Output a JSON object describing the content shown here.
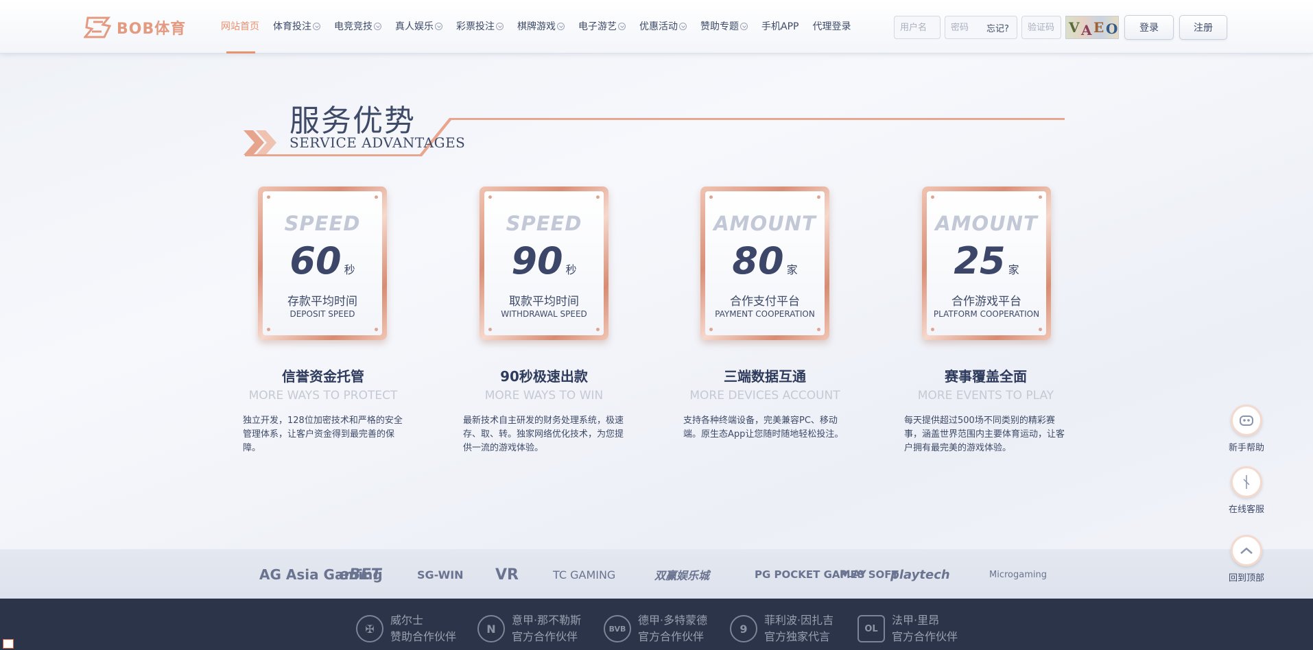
{
  "header": {
    "brand": "BOB体育",
    "nav": [
      {
        "label": "网站首页",
        "active": true,
        "dropdown": false
      },
      {
        "label": "体育投注",
        "active": false,
        "dropdown": true
      },
      {
        "label": "电竞竞技",
        "active": false,
        "dropdown": true
      },
      {
        "label": "真人娱乐",
        "active": false,
        "dropdown": true
      },
      {
        "label": "彩票投注",
        "active": false,
        "dropdown": true
      },
      {
        "label": "棋牌游戏",
        "active": false,
        "dropdown": true
      },
      {
        "label": "电子游艺",
        "active": false,
        "dropdown": true
      },
      {
        "label": "优惠活动",
        "active": false,
        "dropdown": true
      },
      {
        "label": "赞助专题",
        "active": false,
        "dropdown": true
      },
      {
        "label": "手机APP",
        "active": false,
        "dropdown": false
      },
      {
        "label": "代理登录",
        "active": false,
        "dropdown": false
      }
    ],
    "login": {
      "username_placeholder": "用户名",
      "password_placeholder": "密码",
      "forgot_label": "忘记?",
      "captcha_placeholder": "验证码",
      "captcha_text": "VAEO",
      "login_button": "登录",
      "register_button": "注册"
    }
  },
  "section": {
    "title_cn": "服务优势",
    "title_en": "SERVICE ADVANTAGES"
  },
  "cards": [
    {
      "label": "SPEED",
      "number": "60",
      "unit": "秒",
      "cn": "存款平均时间",
      "en": "DEPOSIT SPEED"
    },
    {
      "label": "SPEED",
      "number": "90",
      "unit": "秒",
      "cn": "取款平均时间",
      "en": "WITHDRAWAL SPEED"
    },
    {
      "label": "AMOUNT",
      "number": "80",
      "unit": "家",
      "cn": "合作支付平台",
      "en": "PAYMENT COOPERATION"
    },
    {
      "label": "AMOUNT",
      "number": "25",
      "unit": "家",
      "cn": "合作游戏平台",
      "en": "PLATFORM COOPERATION"
    }
  ],
  "features": [
    {
      "title": "信誉资金托管",
      "subtitle": "MORE WAYS TO PROTECT",
      "desc": "独立开发，128位加密技术和严格的安全管理体系，让客户资金得到最完善的保障。"
    },
    {
      "title": "90秒极速出款",
      "subtitle": "MORE WAYS TO WIN",
      "desc": "最新技术自主研发的财务处理系统，极速存、取、转。独家网络优化技术，为您提供一流的游戏体验。"
    },
    {
      "title": "三端数据互通",
      "subtitle": "MORE DEVICES ACCOUNT",
      "desc": "支持各种终端设备，完美兼容PC、移动端。原生态App让您随时随地轻松投注。"
    },
    {
      "title": "赛事覆盖全面",
      "subtitle": "MORE EVENTS TO PLAY",
      "desc": "每天提供超过500场不同类别的精彩赛事，涵盖世界范围内主要体育运动，让客户拥有最完美的游戏体验。"
    }
  ],
  "partners": [
    "AG Asia Gaming",
    "eBET",
    "SG-WIN",
    "VR",
    "TC GAMING",
    "双赢娱乐城",
    "PG POCKET GAMES SOFT",
    "PLAY",
    "playtech",
    "Microgaming"
  ],
  "sponsors": [
    {
      "name": "威尔士",
      "role": "赞助合作伙伴"
    },
    {
      "name": "意甲·那不勒斯",
      "role": "官方合作伙伴"
    },
    {
      "name": "德甲·多特蒙德",
      "role": "官方合作伙伴"
    },
    {
      "name": "菲利波·因扎吉",
      "role": "官方独家代言"
    },
    {
      "name": "法甲·里昂",
      "role": "官方合作伙伴"
    }
  ],
  "side": {
    "help": "新手帮助",
    "service": "在线客服",
    "top": "回到顶部"
  },
  "colors": {
    "accent": "#e9906f",
    "text": "#3e4a68",
    "footer_bg": "#2b3448"
  }
}
